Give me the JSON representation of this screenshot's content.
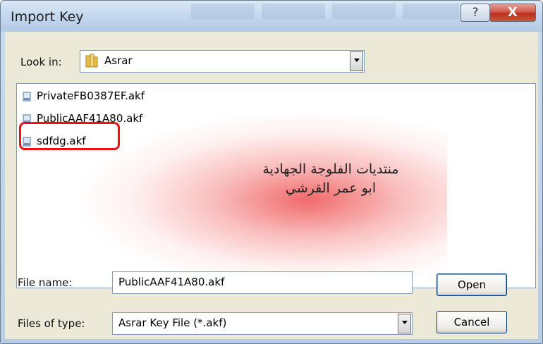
{
  "window": {
    "title": "Import Key",
    "help_glyph": "?",
    "close_glyph": "X"
  },
  "look_in": {
    "label": "Look in:",
    "folder": "Asrar",
    "folder_icon": "folder-icon"
  },
  "toolbar": {
    "icons": [
      "back-arrow-icon",
      "up-folder-icon",
      "new-folder-icon",
      "view-menu-icon"
    ]
  },
  "files": [
    {
      "name": "PrivateFB0387EF.akf",
      "icon": "file-icon"
    },
    {
      "name": "PublicAAF41A80.akf",
      "icon": "file-icon"
    },
    {
      "name": "sdfdg.akf",
      "icon": "file-icon",
      "highlighted": true
    }
  ],
  "watermark": {
    "line1": "منتديات الفلوجة الجهادية",
    "line2": "ابو عمر القرشي",
    "glow_color": "#ee5050"
  },
  "file_name": {
    "label": "File name:",
    "value": "PublicAAF41A80.akf"
  },
  "file_type": {
    "label": "Files of type:",
    "value": "Asrar Key File (*.akf)"
  },
  "buttons": {
    "open": "Open",
    "cancel": "Cancel"
  },
  "colors": {
    "highlight_box": "#ee1111",
    "titlebar": "#c5d9ef",
    "dialog_bg": "#ece9d8"
  }
}
